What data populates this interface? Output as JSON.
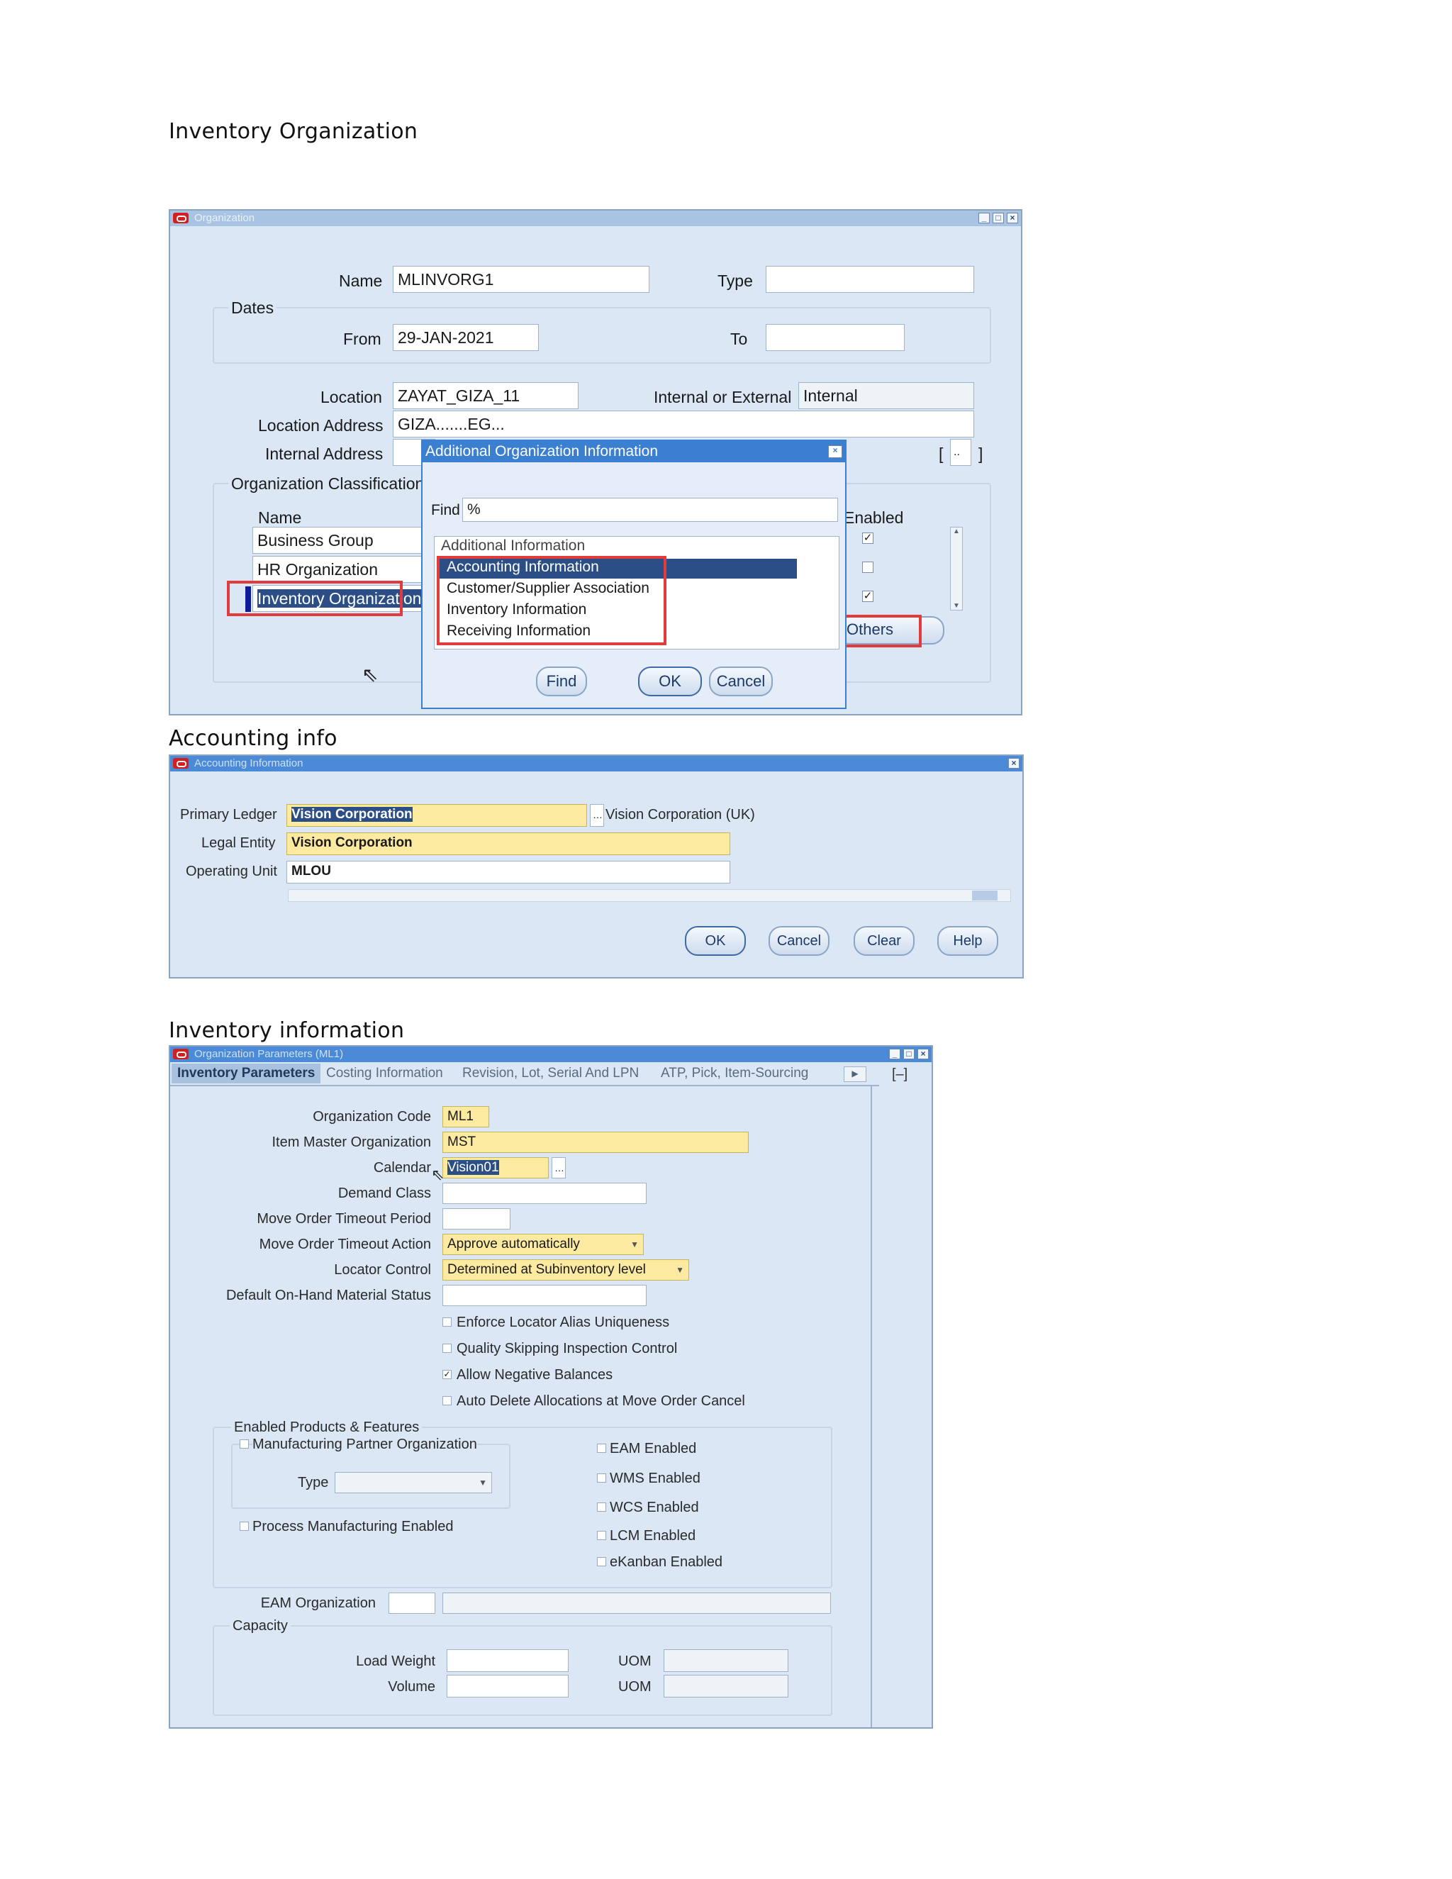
{
  "headings": {
    "inventory_org": "Inventory Organization",
    "accounting_info": "Accounting info",
    "inventory_info": "Inventory information"
  },
  "organization_window": {
    "title": "Organization",
    "name_label": "Name",
    "name_value": "MLINVORG1",
    "type_label": "Type",
    "type_value": "",
    "dates_label": "Dates",
    "from_label": "From",
    "from_value": "29-JAN-2021",
    "to_label": "To",
    "to_value": "",
    "location_label": "Location",
    "location_value": "ZAYAT_GIZA_11",
    "int_ext_label": "Internal or External",
    "int_ext_value": "Internal",
    "location_address_label": "Location Address",
    "location_address_value": "GIZA.......EG...",
    "internal_address_label": "Internal Address",
    "bracket_open": "[",
    "bracket_btn": "..",
    "bracket_close": "]",
    "classifications_label": "Organization Classifications",
    "col_name": "Name",
    "col_enabled": "Enabled",
    "rows": [
      {
        "name": "Business Group",
        "enabled": true
      },
      {
        "name": "HR Organization",
        "enabled": false
      },
      {
        "name": "Inventory Organization",
        "enabled": true
      }
    ],
    "others_button": "Others"
  },
  "additional_info_dialog": {
    "title": "Additional Organization Information",
    "find_label": "Find",
    "find_value": "%",
    "list_header": "Additional Information",
    "items": [
      "Accounting Information",
      "Customer/Supplier Association",
      "Inventory Information",
      "Receiving Information"
    ],
    "btn_find": "Find",
    "btn_ok": "OK",
    "btn_cancel": "Cancel"
  },
  "accounting_window": {
    "title": "Accounting Information",
    "primary_ledger_label": "Primary Ledger",
    "primary_ledger_value": "Vision Corporation",
    "primary_ledger_desc": "Vision Corporation (UK)",
    "legal_entity_label": "Legal Entity",
    "legal_entity_value": "Vision Corporation",
    "operating_unit_label": "Operating Unit",
    "operating_unit_value": "MLOU",
    "btn_ok": "OK",
    "btn_cancel": "Cancel",
    "btn_clear": "Clear",
    "btn_help": "Help"
  },
  "org_params_window": {
    "title": "Organization Parameters (ML1)",
    "tabs": [
      "Inventory Parameters",
      "Costing Information",
      "Revision, Lot, Serial And LPN",
      "ATP, Pick, Item-Sourcing"
    ],
    "org_code_label": "Organization Code",
    "org_code_value": "ML1",
    "item_master_label": "Item Master Organization",
    "item_master_value": "MST",
    "calendar_label": "Calendar",
    "calendar_value": "Vision01",
    "demand_class_label": "Demand Class",
    "move_order_period_label": "Move Order Timeout Period",
    "move_order_action_label": "Move Order Timeout Action",
    "move_order_action_value": "Approve automatically",
    "locator_control_label": "Locator Control",
    "locator_control_value": "Determined at Subinventory level",
    "default_status_label": "Default On-Hand Material Status",
    "checks": [
      {
        "label": "Enforce Locator Alias Uniqueness",
        "checked": false
      },
      {
        "label": "Quality Skipping Inspection Control",
        "checked": false
      },
      {
        "label": "Allow Negative Balances",
        "checked": true
      },
      {
        "label": "Auto Delete Allocations at Move Order Cancel",
        "checked": false
      }
    ],
    "enabled_products_label": "Enabled Products & Features",
    "mfg_partner_label": "Manufacturing Partner Organization",
    "type_label": "Type",
    "process_mfg_label": "Process Manufacturing Enabled",
    "right_checks": [
      "EAM Enabled",
      "WMS Enabled",
      "WCS Enabled",
      "LCM Enabled",
      "eKanban Enabled"
    ],
    "eam_org_label": "EAM Organization",
    "capacity_label": "Capacity",
    "load_weight_label": "Load Weight",
    "volume_label": "Volume",
    "uom_label": "UOM"
  }
}
